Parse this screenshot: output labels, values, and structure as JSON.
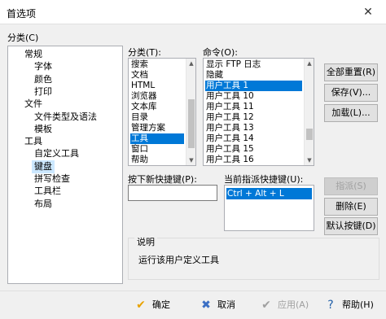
{
  "window": {
    "title": "首选项",
    "close_glyph": "✕"
  },
  "category": {
    "label": "分类(C)",
    "tree": [
      {
        "label": "常规",
        "level": 0
      },
      {
        "label": "字体",
        "level": 1
      },
      {
        "label": "颜色",
        "level": 1
      },
      {
        "label": "打印",
        "level": 1
      },
      {
        "label": "文件",
        "level": 0
      },
      {
        "label": "文件类型及语法",
        "level": 1
      },
      {
        "label": "模板",
        "level": 1
      },
      {
        "label": "工具",
        "level": 0
      },
      {
        "label": "自定义工具",
        "level": 1
      },
      {
        "label": "键盘",
        "level": 1,
        "selected": true
      },
      {
        "label": "拼写检查",
        "level": 1
      },
      {
        "label": "工具栏",
        "level": 1
      },
      {
        "label": "布局",
        "level": 1
      }
    ]
  },
  "classes": {
    "label": "分类(T):",
    "items": [
      "搜索",
      "文档",
      "HTML",
      "浏览器",
      "文本库",
      "目录",
      "管理方案",
      "工具",
      "窗口",
      "帮助"
    ],
    "selected_index": 7
  },
  "commands": {
    "label": "命令(O):",
    "items": [
      "显示 FTP 日志",
      "隐藏",
      "用户工具 1",
      "用户工具 10",
      "用户工具 11",
      "用户工具 12",
      "用户工具 13",
      "用户工具 14",
      "用户工具 15",
      "用户工具 16"
    ],
    "selected_index": 2
  },
  "new_shortcut": {
    "label": "按下新快捷键(P):",
    "value": ""
  },
  "current_shortcut": {
    "label": "当前指派快捷键(U):",
    "items": [
      "Ctrl + Alt + L"
    ]
  },
  "side_buttons": {
    "reset_all": "全部重置(R)",
    "save": "保存(V)...",
    "load": "加载(L)...",
    "assign": "指派(S)",
    "delete": "删除(E)",
    "default_keys": "默认按键(D)"
  },
  "description": {
    "label": "说明",
    "text": "运行该用户定义工具"
  },
  "footer": {
    "ok": "确定",
    "cancel": "取消",
    "apply": "应用(A)",
    "help": "帮助(H)",
    "colors": {
      "ok_check": "#e8a200",
      "cancel_x": "#3b6fc4",
      "help": "#1f5ea8"
    }
  },
  "accent_color": "#0078d7"
}
